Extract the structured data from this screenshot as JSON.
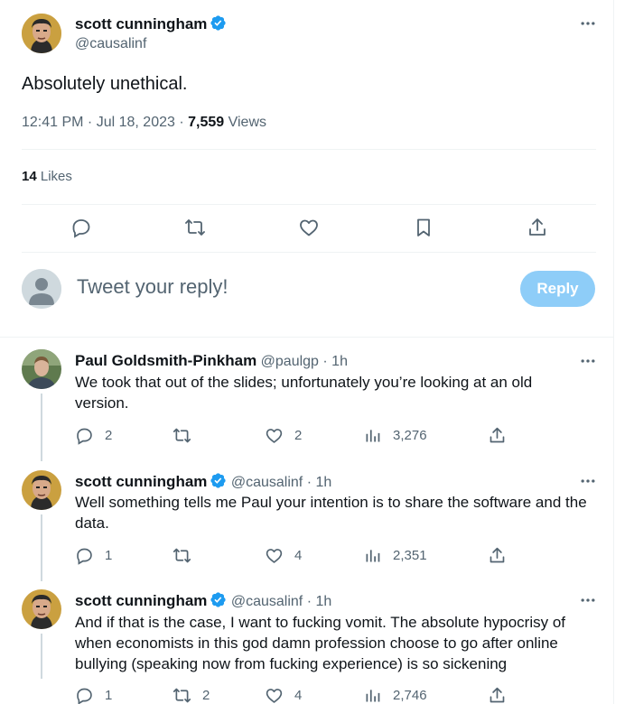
{
  "main_tweet": {
    "author_name": "scott cunningham",
    "author_handle": "@causalinf",
    "text": "Absolutely unethical.",
    "time": "12:41 PM · Jul 18, 2023 · ",
    "views_count": "7,559",
    "views_label": " Views",
    "likes_count": "14",
    "likes_label": " Likes",
    "icons": [
      "reply-icon",
      "retweet-icon",
      "like-icon",
      "bookmark-icon",
      "share-icon"
    ]
  },
  "compose": {
    "placeholder": "Tweet your reply!",
    "button_label": "Reply"
  },
  "replies": [
    {
      "author_name": "Paul Goldsmith-Pinkham",
      "author_handle": "@paulgp",
      "time_ago": " · 1h",
      "verified": false,
      "text": "We took that out of the slides; unfortunately you’re looking at an old version.",
      "reply_count": "2",
      "retweet_count": "",
      "like_count": "2",
      "view_count": "3,276"
    },
    {
      "author_name": "scott cunningham",
      "author_handle": "@causalinf",
      "time_ago": " · 1h",
      "verified": true,
      "text": "Well something tells me Paul your intention is to share the software and the data.",
      "reply_count": "1",
      "retweet_count": "",
      "like_count": "4",
      "view_count": "2,351"
    },
    {
      "author_name": "scott cunningham",
      "author_handle": "@causalinf",
      "time_ago": " · 1h",
      "verified": true,
      "text": "And if that is the case, I want to fucking vomit.  The absolute hypocrisy of when economists in this god damn profession choose to go after online bullying (speaking now from fucking experience) is so sickening",
      "reply_count": "1",
      "retweet_count": "2",
      "like_count": "4",
      "view_count": "2,746"
    }
  ],
  "colors": {
    "accent": "#1d9bf0",
    "reply_button": "#8ecdf8",
    "secondary_text": "#536471",
    "divider": "#eff3f4"
  }
}
